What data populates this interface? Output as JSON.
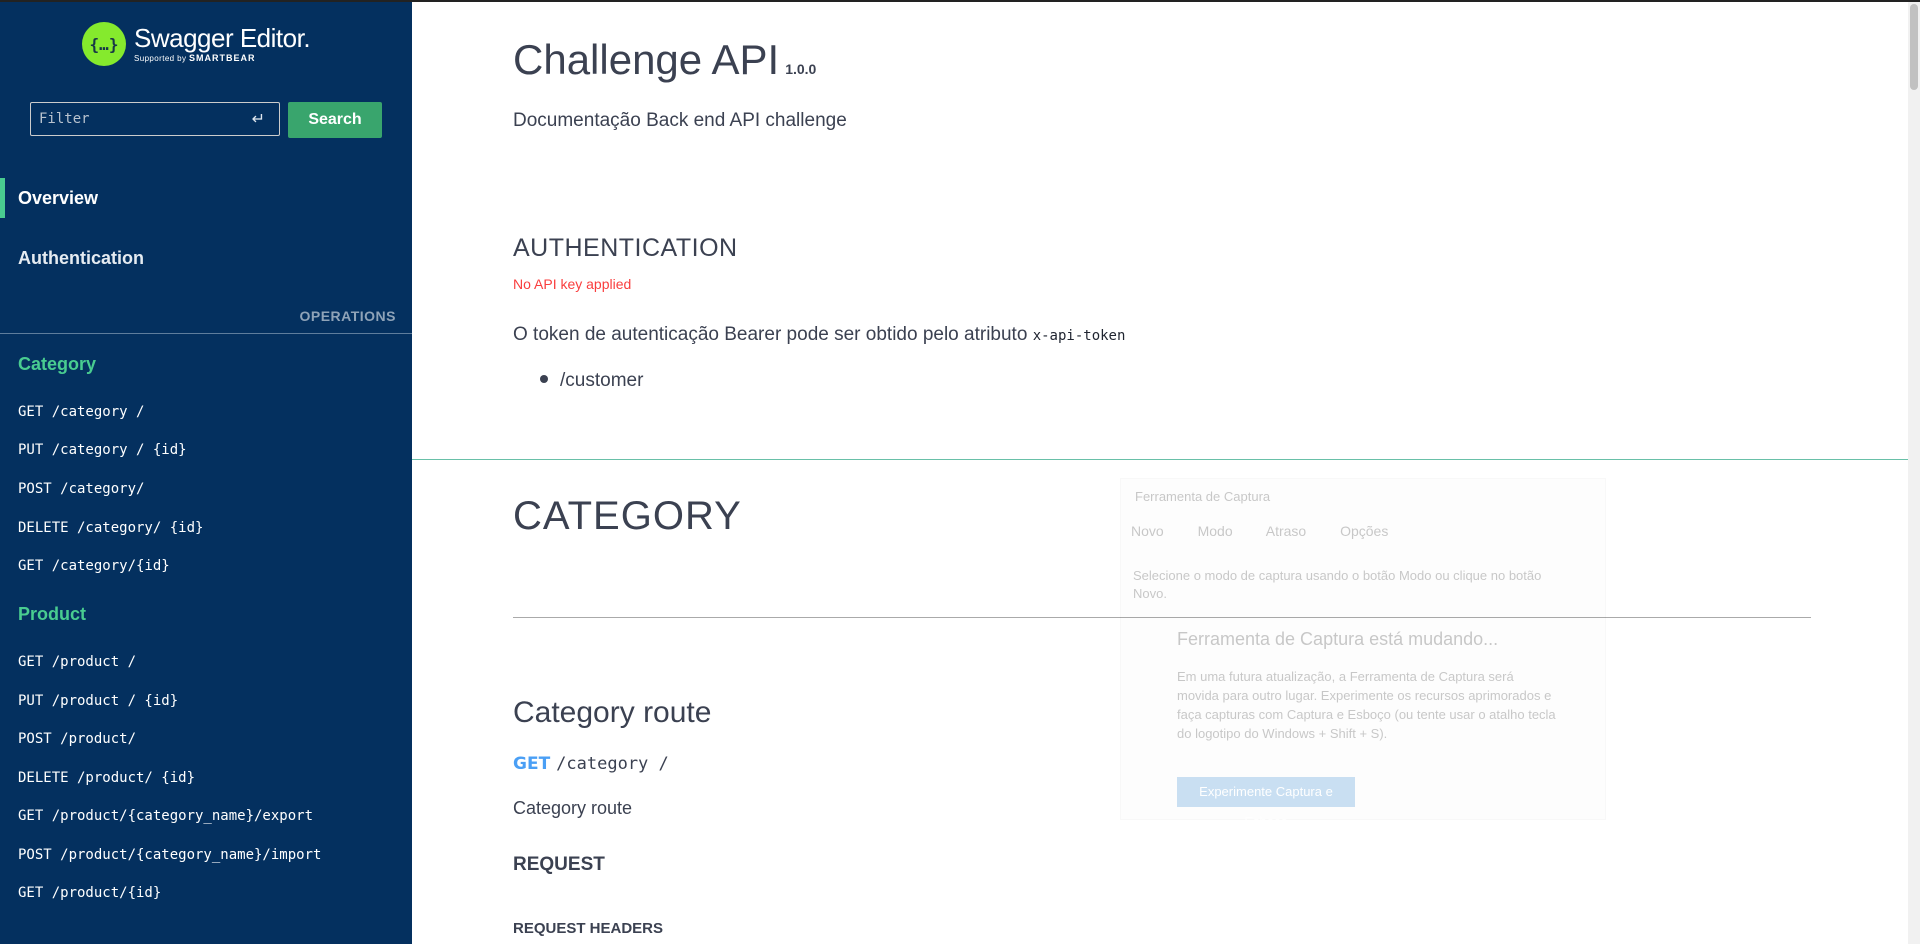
{
  "sidebar": {
    "logo": {
      "title": "Swagger Editor.",
      "supported_by": "Supported by",
      "brand": "SMARTBEAR",
      "mark": "{…}"
    },
    "filter": {
      "placeholder": "Filter",
      "value": ""
    },
    "search_label": "Search",
    "nav": [
      {
        "label": "Overview",
        "active": true
      },
      {
        "label": "Authentication",
        "active": false
      }
    ],
    "operations_header": "OPERATIONS",
    "groups": [
      {
        "title": "Category",
        "ops": [
          "GET /category /",
          "PUT /category / {id}",
          "POST /category/",
          "DELETE /category/ {id}",
          "GET /category/{id}"
        ]
      },
      {
        "title": "Product",
        "ops": [
          "GET /product /",
          "PUT /product / {id}",
          "POST /product/",
          "DELETE /product/ {id}",
          "GET /product/{category_name}/export",
          "POST /product/{category_name}/import",
          "GET /product/{id}"
        ]
      }
    ]
  },
  "main": {
    "title": "Challenge API",
    "version": "1.0.0",
    "description": "Documentação Back end API challenge",
    "auth": {
      "heading": "AUTHENTICATION",
      "warning": "No API key applied",
      "text": "O token de autenticação Bearer pode ser obtido pelo atributo",
      "code": "x-api-token",
      "bullet": "/customer"
    },
    "category": {
      "heading": "CATEGORY",
      "route_heading": "Category route",
      "method": "GET",
      "path": "/category /",
      "route_desc": "Category route",
      "request_heading": "REQUEST",
      "request_headers_heading": "REQUEST HEADERS"
    }
  },
  "overlay": {
    "title": "Ferramenta de Captura",
    "toolbar": [
      "Novo",
      "Modo",
      "Atraso",
      "Opções"
    ],
    "hint": "Selecione o modo de captura usando o botão Modo ou clique no botão Novo.",
    "notice_title": "Ferramenta de Captura está mudando...",
    "notice_body": "Em uma futura atualização, a Ferramenta de Captura será movida para outro lugar. Experimente os recursos aprimorados e faça capturas com Captura e Esboço (ou tente usar o atalho tecla do logotipo do Windows + Shift + S).",
    "notice_button": "Experimente Captura e Esboço"
  },
  "colors": {
    "sidebar_bg": "#04305f",
    "accent_green": "#49cc90",
    "search_green": "#39a56d",
    "get_blue": "#4a9ff5",
    "warn_red": "#f93e3e"
  }
}
